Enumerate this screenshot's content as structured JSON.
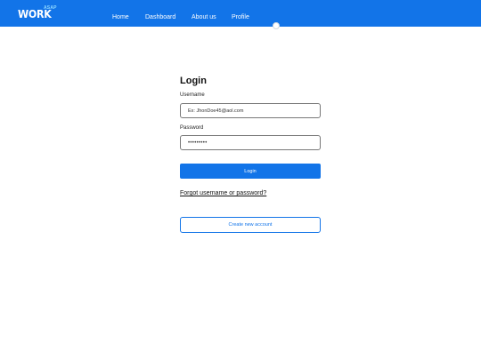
{
  "header": {
    "logo": {
      "main": "WORK",
      "sup": "ASAP"
    },
    "nav": {
      "home": "Home",
      "dashboard": "Dashboard",
      "about": "About us",
      "profile": "Profile"
    }
  },
  "login": {
    "title": "Login",
    "username_label": "Username",
    "username_placeholder": "Ex: JhonDoe45@aol.com",
    "password_label": "Password",
    "password_value": "•••••••••",
    "login_button": "Login",
    "forgot_link": "Forgot username or password?",
    "create_button": "Create new account"
  },
  "colors": {
    "brand": "#1274e8",
    "logo_accent": "#8fd8ff"
  }
}
